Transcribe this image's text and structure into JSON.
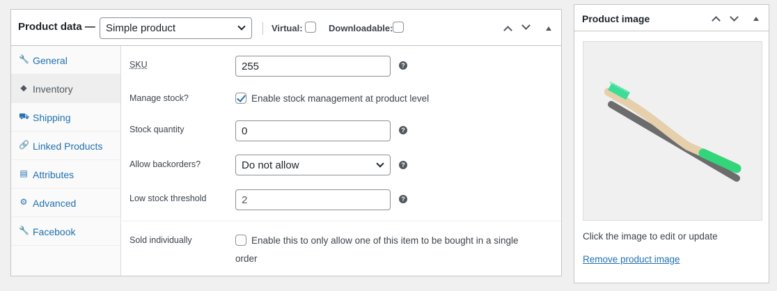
{
  "product_data": {
    "title": "Product data —",
    "product_type": "Simple product",
    "virtual_label": "Virtual:",
    "virtual_checked": false,
    "downloadable_label": "Downloadable:",
    "downloadable_checked": false
  },
  "tabs": [
    {
      "label": "General",
      "icon": "wrench-icon",
      "active": false
    },
    {
      "label": "Inventory",
      "icon": "tag-icon",
      "active": true
    },
    {
      "label": "Shipping",
      "icon": "truck-icon",
      "active": false
    },
    {
      "label": "Linked Products",
      "icon": "link-icon",
      "active": false
    },
    {
      "label": "Attributes",
      "icon": "list-icon",
      "active": false
    },
    {
      "label": "Advanced",
      "icon": "gear-icon",
      "active": false
    },
    {
      "label": "Facebook",
      "icon": "wrench-icon",
      "active": false
    }
  ],
  "inventory": {
    "sku_label": "SKU",
    "sku_value": "255",
    "manage_stock_label": "Manage stock?",
    "manage_stock_text": "Enable stock management at product level",
    "manage_stock_checked": true,
    "stock_qty_label": "Stock quantity",
    "stock_qty_value": "0",
    "backorders_label": "Allow backorders?",
    "backorders_value": "Do not allow",
    "low_stock_label": "Low stock threshold",
    "low_stock_value": "2",
    "sold_individually_label": "Sold individually",
    "sold_individually_text_line1": "Enable this to only allow one of this item to be bought in a single",
    "sold_individually_text_line2": "order",
    "sold_individually_checked": false,
    "help_glyph": "?"
  },
  "product_image": {
    "title": "Product image",
    "hint": "Click the image to edit or update",
    "remove_link": "Remove product image"
  },
  "colors": {
    "accent": "#2271b1",
    "brush_bristle": "#3ddc97",
    "brush_handle": "#e9d2b0",
    "brush_band": "#31d67b"
  }
}
